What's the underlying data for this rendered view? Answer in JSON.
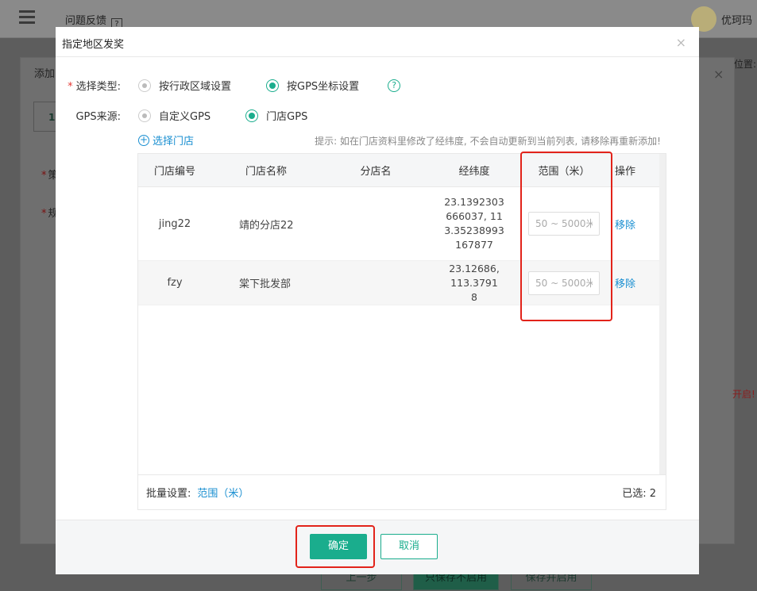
{
  "app": {
    "feedback_label": "问题反馈",
    "feedback_icon": "question-doc-icon",
    "username": "优珂玛"
  },
  "background": {
    "dialog_title": "添加",
    "tab_label": "1",
    "labels": [
      "策",
      "规"
    ],
    "right_text": "位置:",
    "red_text": "开启!",
    "footer_buttons": [
      "上一步",
      "只保存不启用",
      "保存并启用"
    ]
  },
  "modal": {
    "title": "指定地区发奖",
    "select_type": {
      "label": "选择类型:",
      "options": [
        "按行政区域设置",
        "按GPS坐标设置"
      ],
      "selected": "按GPS坐标设置",
      "help": "?"
    },
    "gps_source": {
      "label": "GPS来源:",
      "options": [
        "自定义GPS",
        "门店GPS"
      ],
      "selected": "门店GPS"
    },
    "select_store_label": "选择门店",
    "tip": "提示: 如在门店资料里修改了经纬度, 不会自动更新到当前列表, 请移除再重新添加!",
    "table": {
      "headers": [
        "门店编号",
        "门店名称",
        "分店名",
        "经纬度",
        "范围（米）",
        "操作"
      ],
      "rows": [
        {
          "code": "jing22",
          "name": "靖的分店22",
          "branch": "",
          "coord": "23.1392303666037, 113.35238993167877",
          "range_placeholder": "50 ~ 5000米",
          "action": "移除"
        },
        {
          "code": "fzy",
          "name": "棠下批发部",
          "branch": "",
          "coord": "23.12686, 113.37918",
          "range_placeholder": "50 ~ 5000米",
          "action": "移除"
        }
      ],
      "batch_label": "批量设置:",
      "batch_link": "范围（米）",
      "selected_label": "已选: 2"
    },
    "confirm_label": "确定",
    "cancel_label": "取消"
  },
  "colors": {
    "accent": "#1aad8d",
    "link": "#1a8fd1",
    "annotation": "#e2231a"
  }
}
